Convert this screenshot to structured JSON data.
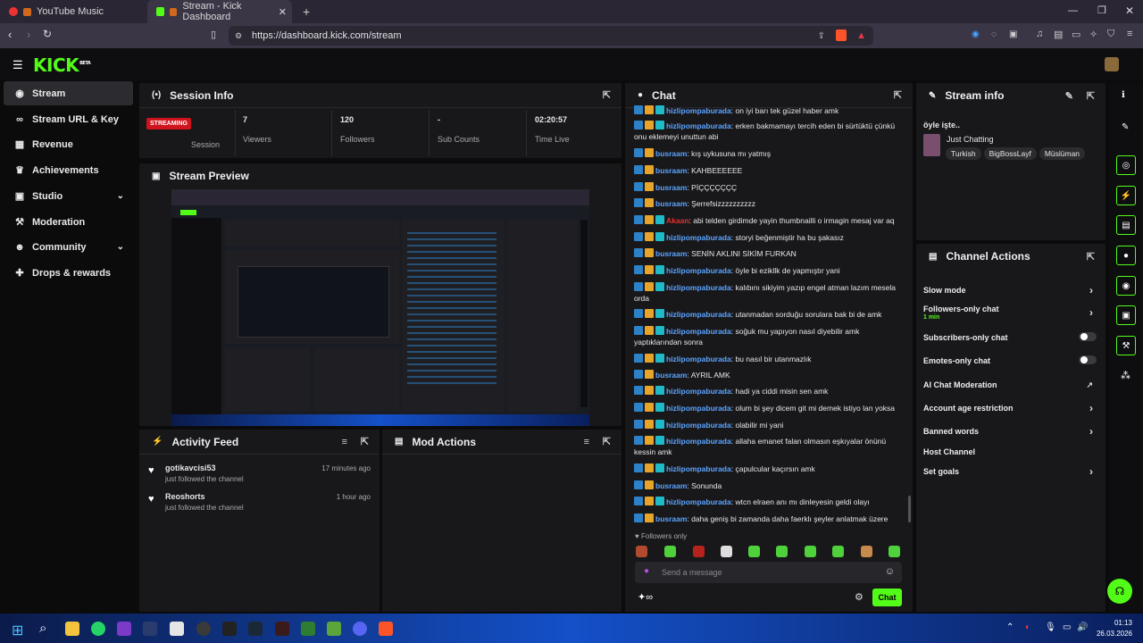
{
  "browser": {
    "tabs": [
      {
        "label": "YouTube Music",
        "active": false
      },
      {
        "label": "Stream - Kick Dashboard",
        "active": true
      }
    ],
    "url": "https://dashboard.kick.com/stream"
  },
  "logo": "KICK",
  "logo_beta": "BETA",
  "sidebar": {
    "items": [
      {
        "label": "Stream",
        "icon": "broadcast-icon",
        "active": true
      },
      {
        "label": "Stream URL & Key",
        "icon": "link-icon"
      },
      {
        "label": "Revenue",
        "icon": "revenue-icon"
      },
      {
        "label": "Achievements",
        "icon": "trophy-icon"
      },
      {
        "label": "Studio",
        "icon": "studio-icon",
        "expandable": true
      },
      {
        "label": "Moderation",
        "icon": "hammer-icon"
      },
      {
        "label": "Community",
        "icon": "community-icon",
        "expandable": true
      },
      {
        "label": "Drops & rewards",
        "icon": "gift-icon"
      }
    ]
  },
  "session": {
    "title": "Session Info",
    "status_badge": "STREAMING",
    "status_label": "Session",
    "viewers": "7",
    "viewers_label": "Viewers",
    "followers": "120",
    "followers_label": "Followers",
    "subs": "-",
    "subs_label": "Sub Counts",
    "time": "02:20:57",
    "time_label": "Time Live"
  },
  "preview": {
    "title": "Stream Preview"
  },
  "activity": {
    "title": "Activity Feed",
    "items": [
      {
        "name": "gotikavcisi53",
        "text": "just followed the channel",
        "time": "17 minutes ago"
      },
      {
        "name": "Reoshorts",
        "text": "just followed the channel",
        "time": "1 hour ago"
      }
    ]
  },
  "mod_actions": {
    "title": "Mod Actions"
  },
  "chat": {
    "title": "Chat",
    "messages": [
      {
        "user": "hizlipompaburada",
        "text": "on iyi barı tek güzel haber amk"
      },
      {
        "user": "hizlipompaburada",
        "text": "erken bakmamayı tercih eden bi sürtüktü çünkü onu eklemeyi unuttun abi"
      },
      {
        "user": "busraam",
        "text": "kış uykusuna mı yatmış"
      },
      {
        "user": "busraam",
        "text": "KAHBEEEEEE"
      },
      {
        "user": "busraam",
        "text": "PİÇÇÇÇÇÇÇ"
      },
      {
        "user": "busraam",
        "text": "Şerrefsizzzzzzzzzz"
      },
      {
        "user": "Akaan",
        "text": "abi telden girdimde yayin thumbnailli o irmagin mesaj var aq"
      },
      {
        "user": "hizlipompaburada",
        "text": "storyi beğenmiştir ha bu şakasız"
      },
      {
        "user": "busraam",
        "text": "SENİN AKLINI SİKİM FURKAN"
      },
      {
        "user": "hizlipompaburada",
        "text": "öyle bi ezikllk de yapmıştır yani"
      },
      {
        "user": "hizlipompaburada",
        "text": "kalıbını sikiyim yazıp engel atman lazım mesela orda"
      },
      {
        "user": "hizlipompaburada",
        "text": "utanmadan sorduğu sorulara bak bi de amk"
      },
      {
        "user": "hizlipompaburada",
        "text": "soğuk mu yapıyon nasıl diyebilir amk yaptıklarından sonra"
      },
      {
        "user": "hizlipompaburada",
        "text": "bu nasıl bir utanmazlık"
      },
      {
        "user": "busraam",
        "text": "AYRIL AMK"
      },
      {
        "user": "hizlipompaburada",
        "text": "hadi ya ciddi misin sen amk"
      },
      {
        "user": "hizlipompaburada",
        "text": "olum bi şey dicem git mi demek istiyo lan yoksa"
      },
      {
        "user": "hizlipompaburada",
        "text": "olabilir mi yani"
      },
      {
        "user": "hizlipompaburada",
        "text": "allaha emanet falan olmasın eşkıyalar önünü kessin amk"
      },
      {
        "user": "hizlipompaburada",
        "text": "çapulcular kaçırsın amk"
      },
      {
        "user": "busraam",
        "text": "Sonunda"
      },
      {
        "user": "hizlipompaburada",
        "text": "wtcn elraen anı mı dinleyesin geldi olayı"
      },
      {
        "user": "busraam",
        "text": "daha geniş bi zamanda daha faerklı şeyler anlatmak üzere"
      }
    ],
    "followers_only": "Followers only",
    "input_placeholder": "Send a message",
    "send_label": "Chat"
  },
  "stream_info": {
    "title": "Stream info",
    "stream_title": "öyle işte..",
    "category": "Just Chatting",
    "tags": [
      "Turkish",
      "BigBossLayf",
      "Müslüman"
    ]
  },
  "channel_actions": {
    "title": "Channel Actions",
    "items": [
      {
        "label": "Slow mode",
        "control": "chevron"
      },
      {
        "label": "Followers-only chat",
        "sub": "1 min",
        "control": "chevron"
      },
      {
        "label": "Subscribers-only chat",
        "control": "toggle"
      },
      {
        "label": "Emotes-only chat",
        "control": "toggle"
      },
      {
        "label": "AI Chat Moderation",
        "control": "external"
      },
      {
        "label": "Account age restriction",
        "control": "chevron"
      },
      {
        "label": "Banned words",
        "control": "chevron"
      },
      {
        "label": "Host Channel",
        "control": "none"
      },
      {
        "label": "Set goals",
        "control": "chevron"
      }
    ]
  },
  "taskbar": {
    "time": "01:13",
    "date": "26.03.2026"
  },
  "colors": {
    "accent": "#53fc18",
    "panel": "#18181b",
    "background": "#0b0b0c",
    "streaming": "#d0141e",
    "username": "#5ba4ff"
  }
}
